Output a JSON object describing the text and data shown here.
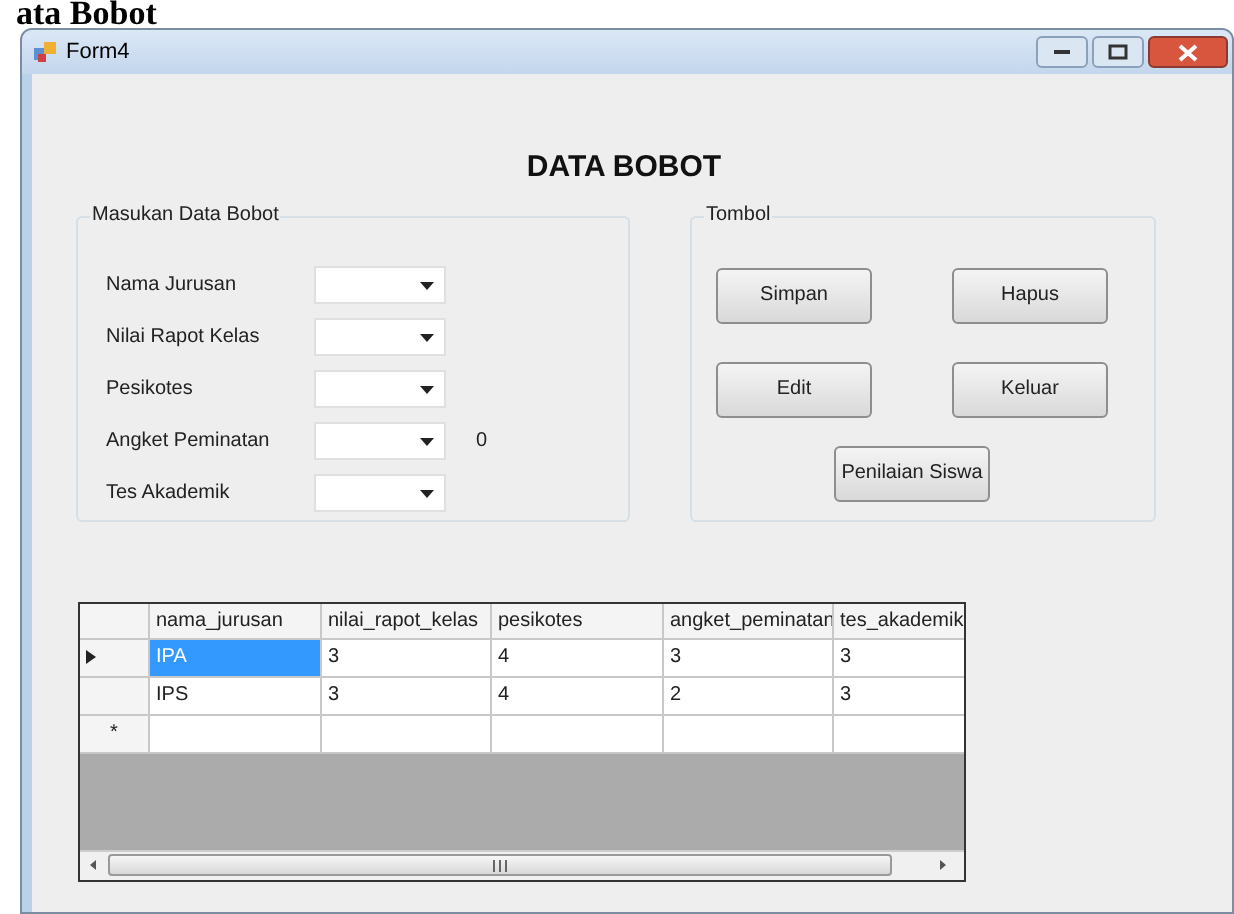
{
  "document_heading": "ata Bobot",
  "window": {
    "title": "Form4"
  },
  "form_title": "DATA BOBOT",
  "input_group": {
    "title": "Masukan Data Bobot",
    "fields": [
      {
        "label": "Nama Jurusan"
      },
      {
        "label": "Nilai Rapot Kelas"
      },
      {
        "label": "Pesikotes"
      },
      {
        "label": "Angket Peminatan",
        "note": "0"
      },
      {
        "label": "Tes Akademik"
      }
    ]
  },
  "button_group": {
    "title": "Tombol",
    "buttons": [
      "Simpan",
      "Hapus",
      "Edit",
      "Keluar",
      "Penilaian Siswa"
    ]
  },
  "table": {
    "columns": [
      "nama_jurusan",
      "nilai_rapot_kelas",
      "pesikotes",
      "angket_peminatan",
      "tes_akademik"
    ],
    "rows": [
      {
        "current": true,
        "cells": [
          {
            "text": "IPA",
            "selected": true
          },
          {
            "text": "3",
            "selected": false
          },
          {
            "text": "4",
            "selected": false
          },
          {
            "text": "3",
            "selected": false
          },
          {
            "text": "3",
            "selected": false
          }
        ]
      },
      {
        "current": false,
        "cells": [
          {
            "text": "IPS",
            "selected": false
          },
          {
            "text": "3",
            "selected": false
          },
          {
            "text": "4",
            "selected": false
          },
          {
            "text": "2",
            "selected": false
          },
          {
            "text": "3",
            "selected": false
          }
        ]
      }
    ],
    "new_row_marker": "*"
  }
}
